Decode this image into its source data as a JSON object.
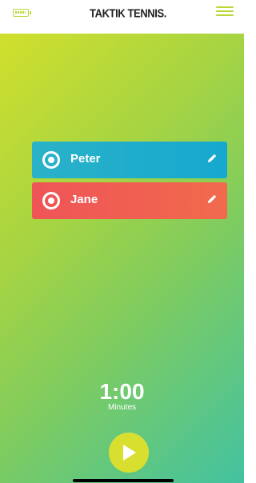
{
  "app": {
    "title": "TAKTIK TENNIS."
  },
  "header": {
    "battery_icon": "battery-icon",
    "menu_icon": "hamburger-menu-icon"
  },
  "players": [
    {
      "name": "Peter",
      "color": "#16a8cf",
      "icon": "player-radio-icon",
      "edit_icon": "pencil-icon"
    },
    {
      "name": "Jane",
      "color": "#ef5457",
      "icon": "player-radio-icon",
      "edit_icon": "pencil-icon"
    }
  ],
  "timer": {
    "value": "1:00",
    "unit": "Minutes"
  },
  "controls": {
    "play_icon": "play-icon",
    "play_color": "#d8df2f"
  },
  "theme": {
    "accent": "#b8d935",
    "background_start": "#d7e12a",
    "background_end": "#43c2a1"
  }
}
